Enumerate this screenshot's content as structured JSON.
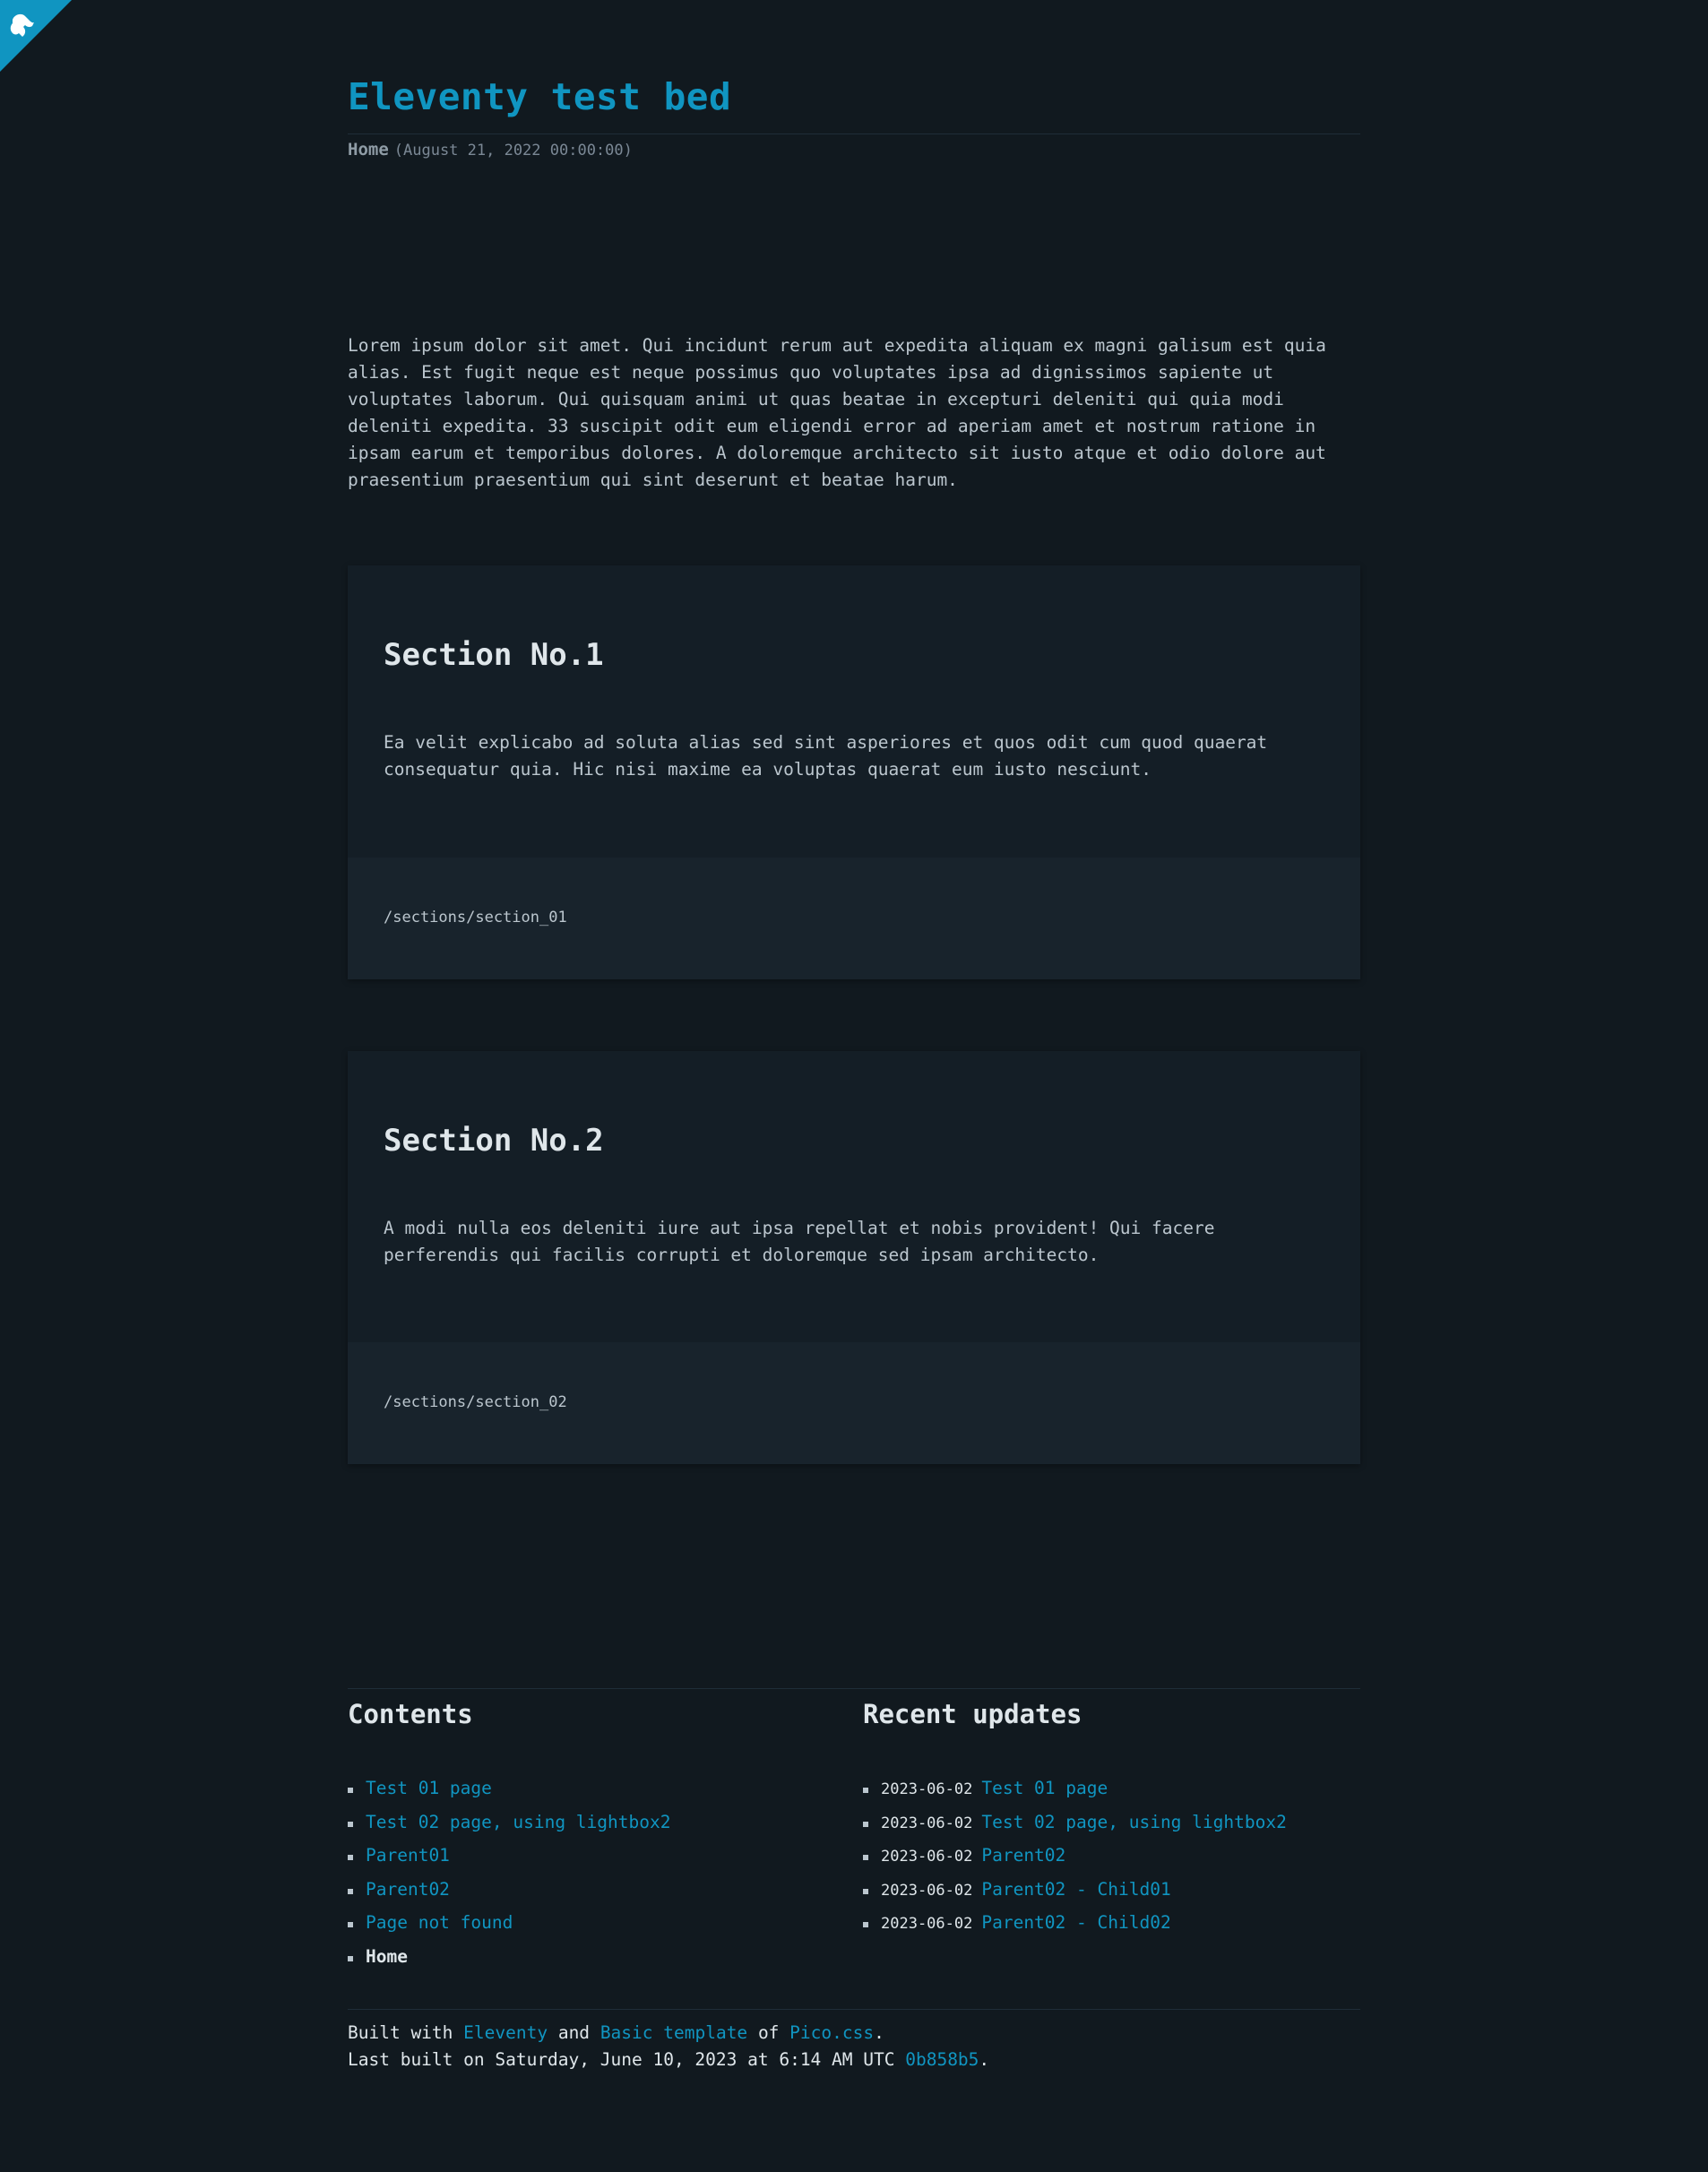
{
  "site": {
    "title": "Eleventy test bed"
  },
  "breadcrumb": {
    "current": "Home",
    "date": "(August 21, 2022 00:00:00)"
  },
  "intro": "Lorem ipsum dolor sit amet. Qui incidunt rerum aut expedita aliquam ex magni galisum est quia alias. Est fugit neque est neque possimus quo voluptates ipsa ad dignissimos sapiente ut voluptates laborum. Qui quisquam animi ut quas beatae in excepturi deleniti qui quia modi deleniti expedita. 33 suscipit odit eum eligendi error ad aperiam amet et nostrum ratione in ipsam earum et temporibus dolores. A doloremque architecto sit iusto atque et odio dolore aut praesentium praesentium qui sint deserunt et beatae harum.",
  "sections": [
    {
      "title": "Section No.1",
      "body": "Ea velit explicabo ad soluta alias sed sint asperiores et quos odit cum quod quaerat consequatur quia. Hic nisi maxime ea voluptas quaerat eum iusto nesciunt.",
      "path": "/sections/section_01"
    },
    {
      "title": "Section No.2",
      "body": "A modi nulla eos deleniti iure aut ipsa repellat et nobis provident! Qui facere perferendis qui facilis corrupti et doloremque sed ipsam architecto.",
      "path": "/sections/section_02"
    }
  ],
  "contents": {
    "heading": "Contents",
    "items": [
      "Test 01 page",
      "Test 02 page, using lightbox2",
      "Parent01",
      "Parent02",
      "Page not found",
      "Home"
    ]
  },
  "recent": {
    "heading": "Recent updates",
    "items": [
      {
        "date": "2023-06-02",
        "label": "Test 01 page"
      },
      {
        "date": "2023-06-02",
        "label": "Test 02 page, using lightbox2"
      },
      {
        "date": "2023-06-02",
        "label": "Parent02"
      },
      {
        "date": "2023-06-02",
        "label": "Parent02 - Child01"
      },
      {
        "date": "2023-06-02",
        "label": "Parent02 - Child02"
      }
    ]
  },
  "footer": {
    "built_with": "Built with",
    "eleventy": "Eleventy",
    "and": "and",
    "basic_template": "Basic template",
    "of": "of",
    "pico": "Pico.css",
    "period": ".",
    "last_built": "Last built on Saturday, June 10, 2023 at 6:14 AM UTC",
    "commit": "0b858b5"
  },
  "colors": {
    "accent": "#1095c1",
    "background": "#11191f",
    "card": "#141e26",
    "card_footer": "#18232c"
  },
  "icons": {
    "corner": "github-corner-icon"
  }
}
